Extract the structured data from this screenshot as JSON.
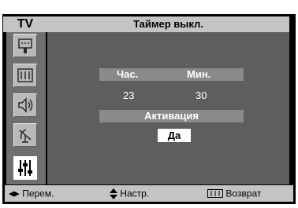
{
  "header": {
    "tv_label": "TV",
    "title": "Таймер выкл."
  },
  "sidebar": {
    "items": [
      {
        "icon": "input-icon"
      },
      {
        "icon": "picture-icon"
      },
      {
        "icon": "sound-icon"
      },
      {
        "icon": "channel-icon"
      },
      {
        "icon": "setup-icon",
        "active": true
      }
    ]
  },
  "timer": {
    "hours_label": "Час.",
    "minutes_label": "Мин.",
    "hours_value": "23",
    "minutes_value": "30",
    "activation_label": "Активация",
    "activation_value": "Да"
  },
  "footer": {
    "move_label": "Перем.",
    "adjust_label": "Настр.",
    "return_label": "Возврат"
  },
  "colors": {
    "bar": "#c4c4c4",
    "panel": "#5e5e5e",
    "sidebar": "#6f6f6f",
    "highlight": "#8a8a8a"
  }
}
